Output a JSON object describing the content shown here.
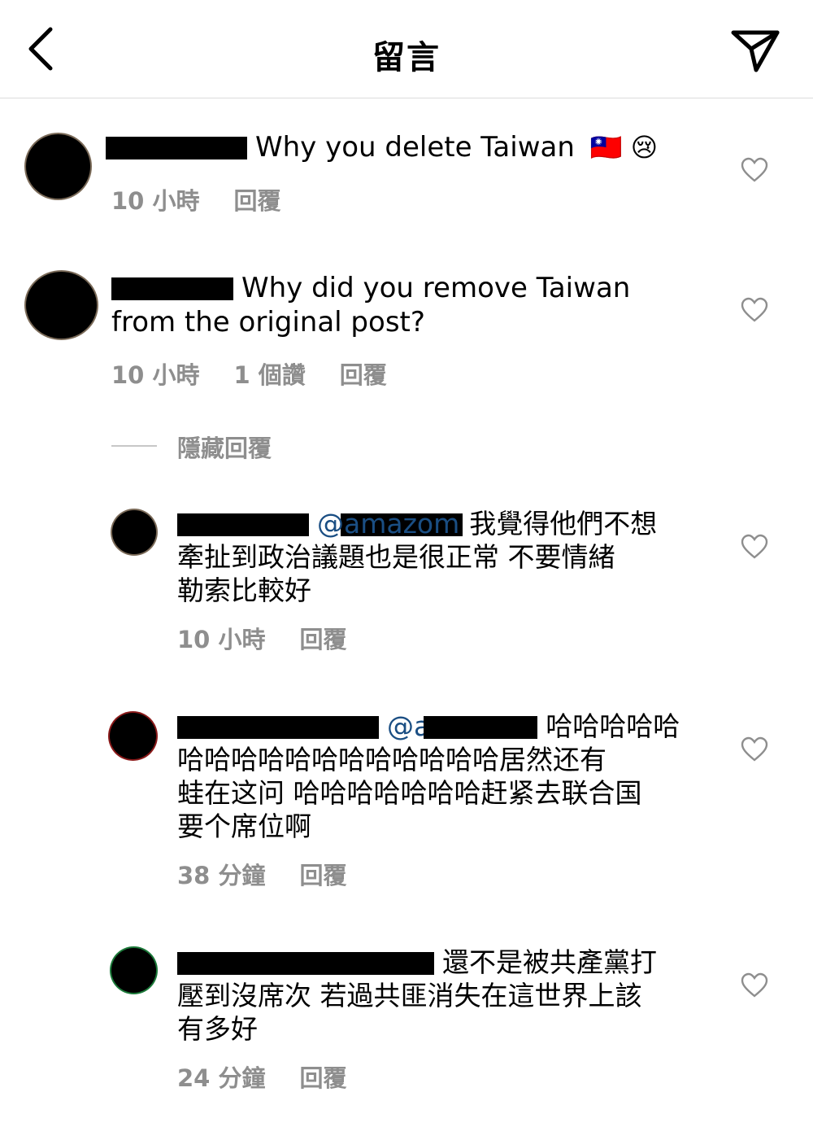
{
  "header": {
    "title": "留言",
    "back_icon": "chevron-left-icon",
    "share_icon": "paper-plane-icon"
  },
  "comments": [
    {
      "text": "Why you delete Taiwan",
      "emoji": "🇹🇼 😢",
      "time": "10 小時",
      "likes": "",
      "reply": "回覆"
    },
    {
      "text_line1": "Why did you remove Taiwan",
      "text_line2": "from the original post?",
      "time": "10 小時",
      "likes": "1 個讚",
      "reply": "回覆"
    }
  ],
  "hide_replies": "隱藏回覆",
  "replies": [
    {
      "mention": "@amazom",
      "lines": [
        "我覺得他們不想",
        "牽扯到政治議題也是很正常  不要情緒",
        "勒索比較好"
      ],
      "time": "10 小時",
      "reply": "回覆"
    },
    {
      "mention": "@a",
      "lines": [
        "哈哈哈哈哈",
        "哈哈哈哈哈哈哈哈哈哈哈哈居然还有",
        "蛙在这问 哈哈哈哈哈哈哈赶紧去联合国",
        "要个席位啊"
      ],
      "time": "38 分鐘",
      "reply": "回覆"
    },
    {
      "mention": "",
      "lines": [
        "還不是被共產黨打",
        "壓到沒席次 若過共匪消失在這世界上該",
        "有多好"
      ],
      "time": "24 分鐘",
      "reply": "回覆"
    }
  ],
  "colors": {
    "meta": "#8e8e8e",
    "mention": "#1a4e83",
    "divider": "#dbdbdb"
  }
}
